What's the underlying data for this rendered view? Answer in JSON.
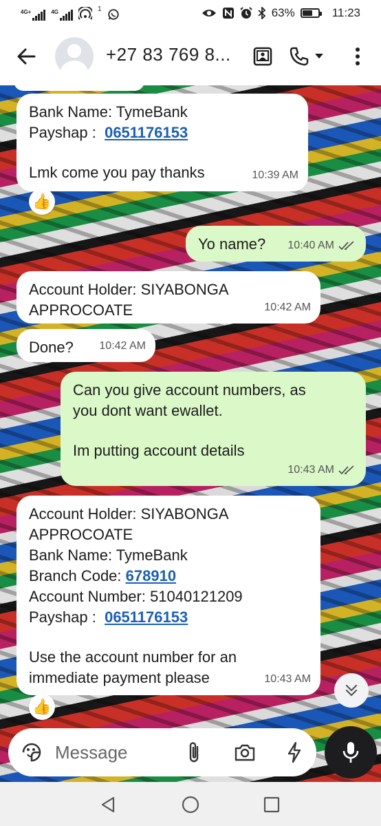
{
  "status_bar": {
    "sim1_tag": "4G+",
    "sim2_tag": "4G",
    "hotspot_badge": "1",
    "battery": "63%",
    "battery_level": 0.63,
    "time": "11:23"
  },
  "app_bar": {
    "contact": "+27 83 769 8..."
  },
  "messages": [
    {
      "direction": "in",
      "lines": [
        {
          "text": "Bank Name: TymeBank"
        },
        {
          "text": "Payshap :  ",
          "link": "0651176153"
        },
        {
          "gap": true
        },
        {
          "text": "Lmk come you pay thanks"
        }
      ],
      "time": "10:39 AM",
      "reaction": "👍"
    },
    {
      "direction": "out",
      "lines": [
        {
          "text": "Yo name?"
        }
      ],
      "time": "10:40 AM",
      "read": true
    },
    {
      "direction": "in",
      "lines": [
        {
          "text": "Account Holder: SIYABONGA"
        },
        {
          "text": "APPROCOATE"
        }
      ],
      "time": "10:42 AM"
    },
    {
      "direction": "in",
      "lines": [
        {
          "text": "Done?"
        }
      ],
      "time": "10:42 AM"
    },
    {
      "direction": "out",
      "lines": [
        {
          "text": "Can you give account numbers, as"
        },
        {
          "text": "you dont want ewallet."
        },
        {
          "gap": true
        },
        {
          "text": "Im putting account details"
        }
      ],
      "time": "10:43 AM",
      "read": true
    },
    {
      "direction": "in",
      "lines": [
        {
          "text": "Account Holder: SIYABONGA"
        },
        {
          "text": "APPROCOATE"
        },
        {
          "text": "Bank Name: TymeBank"
        },
        {
          "text": "Branch Code: ",
          "link": "678910"
        },
        {
          "text": "Account Number: 51040121209"
        },
        {
          "text": "Payshap :  ",
          "link": "0651176153"
        },
        {
          "gap": true
        },
        {
          "text": "Use the account number for an"
        },
        {
          "text": "immediate payment please"
        }
      ],
      "time": "10:43 AM",
      "reaction": "👍"
    }
  ],
  "composer": {
    "placeholder": "Message"
  },
  "colors": {
    "incoming": "#ffffff",
    "outgoing": "#dbf8c8",
    "link": "#1a5fb4",
    "read_tick": "#555555"
  }
}
